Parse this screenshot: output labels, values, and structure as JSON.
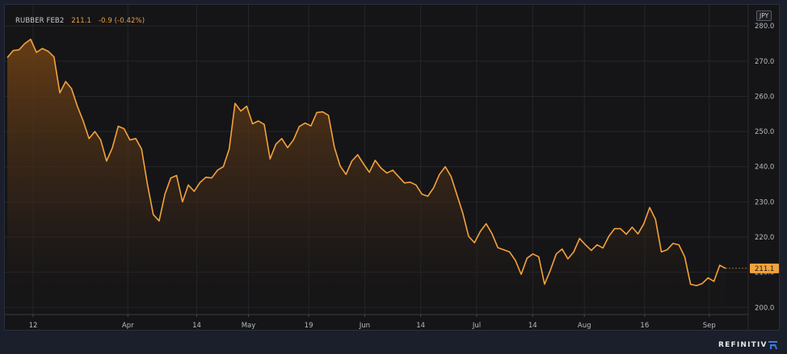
{
  "header": {
    "ticker": "RUBBER FEB2",
    "last_price": "211.1",
    "change": "-0.9 (-0.42%)",
    "currency": "JPY"
  },
  "footer": {
    "brand": "REFINITIV"
  },
  "colors": {
    "line": "#f4a23c",
    "background": "#151517",
    "grid": "#26272b",
    "price_label_bg": "#f4a23c"
  },
  "chart_data": {
    "type": "area",
    "title": "",
    "xlabel": "",
    "ylabel": "",
    "ylim": [
      198,
      286
    ],
    "y_ticks": [
      "280.0",
      "270.0",
      "260.0",
      "250.0",
      "240.0",
      "230.0",
      "220.0",
      "210.0",
      "200.0"
    ],
    "x_tick_labels": [
      "12",
      "Apr",
      "14",
      "May",
      "19",
      "Jun",
      "14",
      "Jul",
      "14",
      "Aug",
      "16",
      "Sep"
    ],
    "last_price_label": "211.1",
    "grid": true,
    "series": [
      {
        "values": [
          271,
          273,
          273.2,
          275,
          276.2,
          272.5,
          273.6,
          272.8,
          271.2,
          261,
          264.2,
          262.2,
          257.2,
          253,
          248,
          250,
          247.6,
          241.6,
          245.4,
          251.5,
          250.8,
          247.6,
          248,
          245,
          235,
          226.4,
          224.6,
          232.2,
          236.8,
          237.5,
          230,
          234.8,
          233,
          235.5,
          237,
          236.8,
          239,
          240,
          245,
          258,
          255.8,
          257.2,
          252.2,
          253,
          252,
          242.2,
          246.4,
          248,
          245.4,
          247.6,
          251.4,
          252.4,
          251.6,
          255.4,
          255.6,
          254.6,
          245.6,
          240.2,
          237.8,
          241.6,
          243.4,
          240.8,
          238.4,
          241.8,
          239.6,
          238.2,
          239,
          237.2,
          235.4,
          235.6,
          234.8,
          232.2,
          231.6,
          234,
          237.8,
          240,
          237.2,
          232,
          226.8,
          220.2,
          218.4,
          221.6,
          223.8,
          221,
          217,
          216.4,
          215.8,
          213.4,
          209.4,
          214,
          215.2,
          214.4,
          206.6,
          210.6,
          215.2,
          216.6,
          213.8,
          215.8,
          219.6,
          217.8,
          216.2,
          217.8,
          216.9,
          220.2,
          222.4,
          222.4,
          220.8,
          222.8,
          220.9,
          223.8,
          228.4,
          225,
          215.8,
          216.4,
          218.2,
          217.8,
          214.4,
          206.6,
          206.2,
          206.8,
          208.4,
          207.4,
          212,
          211.1
        ]
      }
    ]
  }
}
